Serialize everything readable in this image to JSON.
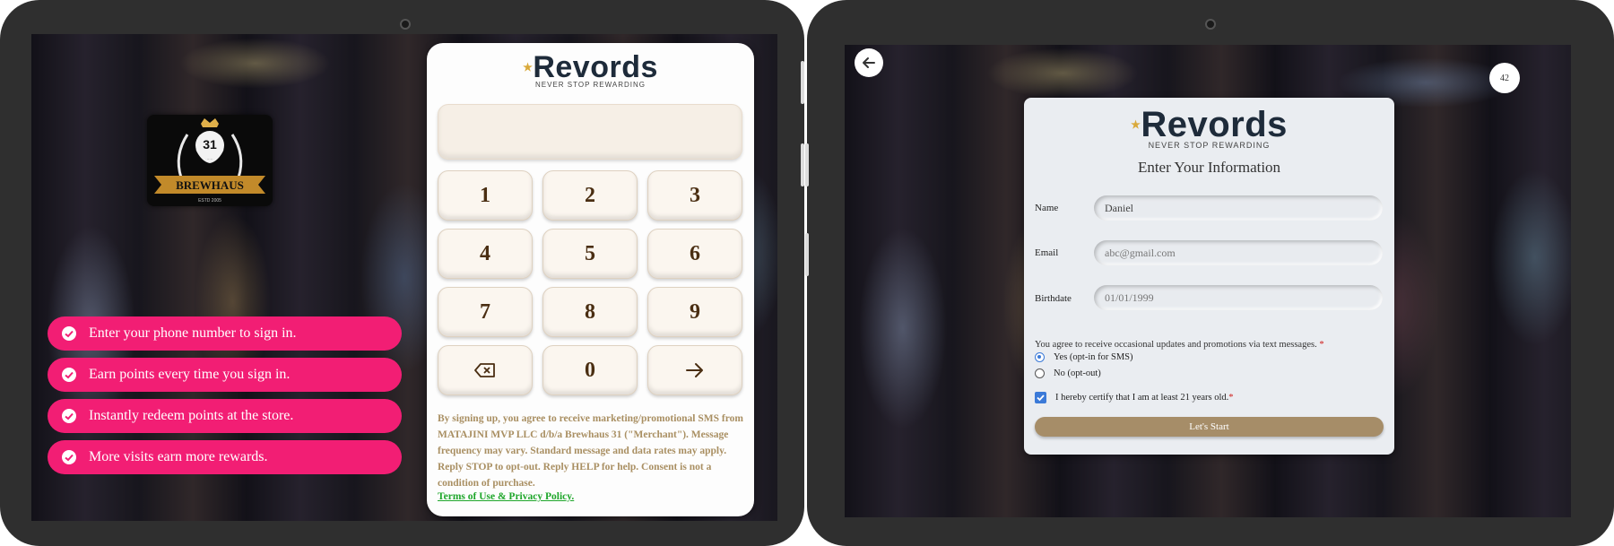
{
  "brand": {
    "logo_text": "Revords",
    "tagline": "NEVER STOP REWARDING"
  },
  "merchant_logo": {
    "number": "31",
    "name": "BREWHAUS",
    "est": "ESTD 2005"
  },
  "signin_screen": {
    "tips": [
      {
        "text": "Enter your phone number to sign in."
      },
      {
        "text": "Earn points every time you sign in."
      },
      {
        "text": "Instantly redeem points at the store."
      },
      {
        "text": "More visits earn more rewards."
      }
    ],
    "phone_display_value": "",
    "keypad": [
      "1",
      "2",
      "3",
      "4",
      "5",
      "6",
      "7",
      "8",
      "9",
      "0"
    ],
    "disclaimer": "By signing up, you agree to receive marketing/promotional SMS from MATAJINI MVP LLC d/b/a Brewhaus 31 (\"Merchant\"). Message frequency may vary. Standard message and data rates may apply. Reply STOP to opt-out. Reply HELP for help. Consent is not a condition of purchase.",
    "terms_link": "Terms of Use & Privacy Policy."
  },
  "info_screen": {
    "timer": "42",
    "title": "Enter Your Information",
    "fields": {
      "name": {
        "label": "Name",
        "value": "Daniel"
      },
      "email": {
        "label": "Email",
        "placeholder": "abc@gmail.com"
      },
      "birthdate": {
        "label": "Birthdate",
        "placeholder": "01/01/1999"
      }
    },
    "consent_text": "You agree to receive occasional updates and promotions via text messages.",
    "required_mark": "*",
    "options": [
      {
        "label": "Yes (opt-in for SMS)",
        "selected": true
      },
      {
        "label": "No (opt-out)",
        "selected": false
      }
    ],
    "age_certify": "I hereby certify that I am at least 21 years old.",
    "start_button": "Let's Start"
  },
  "colors": {
    "tip_pink": "#f21e74",
    "keypad_text": "#4a2e12",
    "disclaimer_gold": "#a98f62",
    "terms_green": "#1ea62a",
    "start_button": "#a68d68",
    "radio_blue": "#3b7ad8"
  }
}
